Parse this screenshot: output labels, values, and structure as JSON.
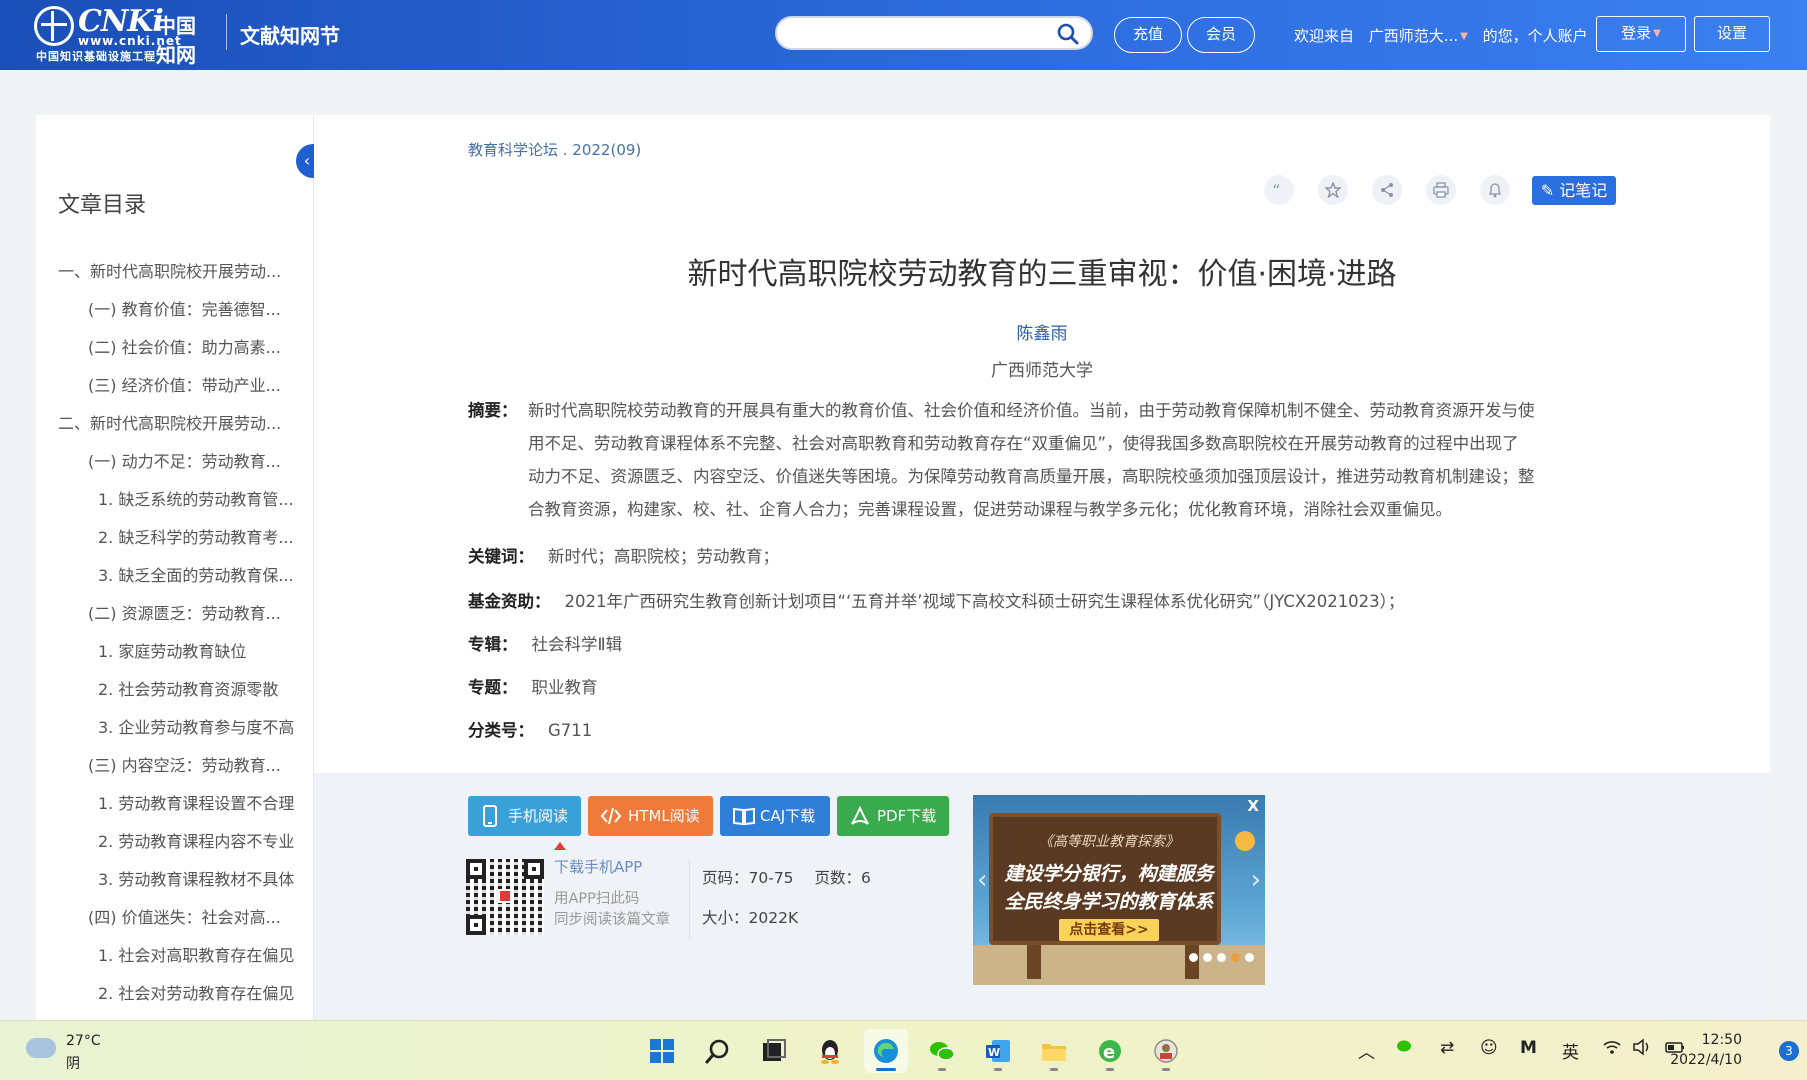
{
  "header": {
    "logo_brand": "CNKi",
    "logo_cn": "中国知网",
    "logo_url": "www.cnki.net",
    "logo_sub": "中国知识基础设施工程",
    "section_name": "文献知网节",
    "search_value": "",
    "recharge_label": "充值",
    "member_label": "会员",
    "welcome_prefix": "欢迎来自",
    "institution": "广西师范大...",
    "welcome_suffix": "的您，个人账户",
    "login_label": "登录",
    "settings_label": "设置"
  },
  "sidebar": {
    "title": "文章目录",
    "items": [
      {
        "level": 1,
        "label": "一、新时代高职院校开展劳动..."
      },
      {
        "level": 2,
        "label": "(一) 教育价值：完善德智..."
      },
      {
        "level": 2,
        "label": "(二) 社会价值：助力高素..."
      },
      {
        "level": 2,
        "label": "(三) 经济价值：带动产业..."
      },
      {
        "level": 1,
        "label": "二、新时代高职院校开展劳动..."
      },
      {
        "level": 2,
        "label": "(一) 动力不足：劳动教育..."
      },
      {
        "level": 3,
        "label": "1. 缺乏系统的劳动教育管..."
      },
      {
        "level": 3,
        "label": "2. 缺乏科学的劳动教育考..."
      },
      {
        "level": 3,
        "label": "3. 缺乏全面的劳动教育保..."
      },
      {
        "level": 2,
        "label": "(二) 资源匮乏：劳动教育..."
      },
      {
        "level": 3,
        "label": "1. 家庭劳动教育缺位"
      },
      {
        "level": 3,
        "label": "2. 社会劳动教育资源零散"
      },
      {
        "level": 3,
        "label": "3. 企业劳动教育参与度不高"
      },
      {
        "level": 2,
        "label": "(三) 内容空泛：劳动教育..."
      },
      {
        "level": 3,
        "label": "1. 劳动教育课程设置不合理"
      },
      {
        "level": 3,
        "label": "2. 劳动教育课程内容不专业"
      },
      {
        "level": 3,
        "label": "3. 劳动教育课程教材不具体"
      },
      {
        "level": 2,
        "label": "(四) 价值迷失：社会对高..."
      },
      {
        "level": 3,
        "label": "1. 社会对高职教育存在偏见"
      },
      {
        "level": 3,
        "label": "2. 社会对劳动教育存在偏见"
      }
    ]
  },
  "article": {
    "breadcrumb": "教育科学论坛 . 2022(09)",
    "note_label": "记笔记",
    "title": "新时代高职院校劳动教育的三重审视：价值·困境·进路",
    "author": "陈鑫雨",
    "affiliation": "广西师范大学",
    "abstract_label": "摘要：",
    "abstract_lines": [
      "新时代高职院校劳动教育的开展具有重大的教育价值、社会价值和经济价值。当前，由于劳动教育保障机制不健全、劳动教育资源开发与使",
      "用不足、劳动教育课程体系不完整、社会对高职教育和劳动教育存在“双重偏见”，使得我国多数高职院校在开展劳动教育的过程中出现了",
      "动力不足、资源匮乏、内容空泛、价值迷失等困境。为保障劳动教育高质量开展，高职院校亟须加强顶层设计，推进劳动教育机制建设；整",
      "合教育资源，构建家、校、社、企育人合力；完善课程设置，促进劳动课程与教学多元化；优化教育环境，消除社会双重偏见。"
    ],
    "keywords_label": "关键词：",
    "keywords": "新时代；高职院校；劳动教育；",
    "fund_label": "基金资助：",
    "fund": "2021年广西研究生教育创新计划项目“‘五育并举’视域下高校文科硕士研究生课程体系优化研究”（JYCX2021023）；",
    "series_label": "专辑：",
    "series": "社会科学Ⅱ辑",
    "topic_label": "专题：",
    "topic": "职业教育",
    "class_label": "分类号：",
    "class_code": "G711"
  },
  "downloads": {
    "mobile_label": "手机阅读",
    "html_label": "HTML阅读",
    "caj_label": "CAJ下载",
    "pdf_label": "PDF下载",
    "mobile_color": "#3aa0d8",
    "html_color": "#f07a3a",
    "caj_color": "#2f7fd8",
    "pdf_color": "#3aaa4e",
    "app_link": "下载手机APP",
    "app_hint1": "用APP扫此码",
    "app_hint2": "同步阅读该篇文章",
    "pages_text": "页码：70-75",
    "page_count_text": "页数：6",
    "size_text": "大小：2022K"
  },
  "ad": {
    "small": "《高等职业教育探索》",
    "line1": "建设学分银行，构建服务",
    "line2": "全民终身学习的教育体系",
    "cta": "点击查看>>",
    "close": "X"
  },
  "taskbar": {
    "temperature": "27°C",
    "weather": "阴",
    "tray_ime": "英",
    "time": "12:50",
    "date": "2022/4/10",
    "notifications": "3"
  }
}
